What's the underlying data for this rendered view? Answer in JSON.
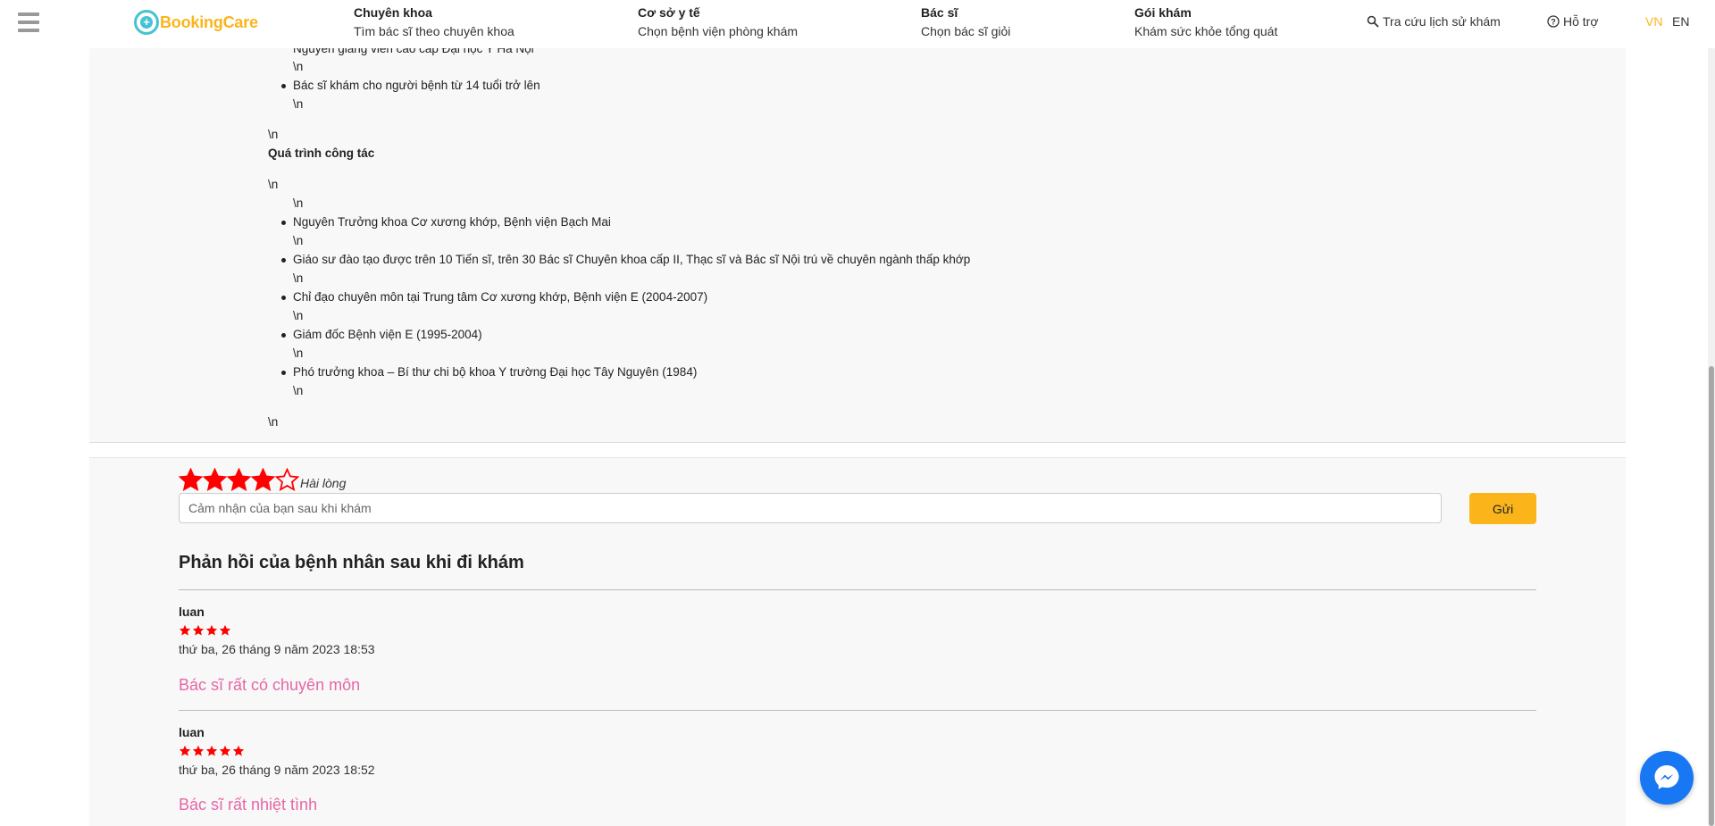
{
  "header": {
    "logo_text": "BookingCare",
    "nav": [
      {
        "title": "Chuyên khoa",
        "subtitle": "Tìm bác sĩ theo chuyên khoa"
      },
      {
        "title": "Cơ sở y tế",
        "subtitle": "Chọn bệnh viện phòng khám"
      },
      {
        "title": "Bác sĩ",
        "subtitle": "Chọn bác sĩ giỏi"
      },
      {
        "title": "Gói khám",
        "subtitle": "Khám sức khỏe tổng quát"
      }
    ],
    "history_label": "Tra cứu lịch sử khám",
    "support_label": "Hỗ trợ",
    "lang_vn": "VN",
    "lang_en": "EN",
    "active_lang_color": "#fbb51a"
  },
  "doctor_info": {
    "partial_line": "Nguyên giảng viên cao cấp Đại học Y Hà Nội",
    "newline_marker": "\\n",
    "age_line": "Bác sĩ khám cho người bệnh từ 14 tuổi trở lên",
    "work_heading": "Quá trình công tác",
    "work_items": [
      "Nguyên Trưởng khoa Cơ xương khớp, Bệnh viện Bạch Mai",
      "Giáo sư đào tạo được trên 10 Tiến sĩ, trên 30 Bác sĩ Chuyên khoa cấp II, Thạc sĩ và Bác sĩ Nội trú về chuyên ngành thấp khớp",
      "Chỉ đạo chuyên môn tại Trung tâm Cơ xương khớp, Bệnh viện E (2004-2007)",
      "Giám đốc Bệnh viện E (1995-2004)",
      "Phó trưởng khoa – Bí thư chi bộ khoa Y trường Đại học Tây Nguyên (1984)"
    ]
  },
  "rating_form": {
    "selected_stars": 4,
    "max_stars": 5,
    "rating_label": "Hài lòng",
    "placeholder": "Cảm nhận của bạn sau khi khám",
    "submit_label": "Gửi",
    "star_color": "#ff0000"
  },
  "feedback": {
    "title": "Phản hồi của bệnh nhân sau khi đi khám",
    "reviews": [
      {
        "name": "luan",
        "stars": 4,
        "date": "thứ ba, 26 tháng 9 năm 2023 18:53",
        "comment": "Bác sĩ rất có chuyên môn"
      },
      {
        "name": "luan",
        "stars": 5,
        "date": "thứ ba, 26 tháng 9 năm 2023 18:52",
        "comment": "Bác sĩ rất nhiệt tình"
      }
    ],
    "comment_color": "#e766a7"
  },
  "messenger": {
    "icon": "messenger-icon"
  }
}
